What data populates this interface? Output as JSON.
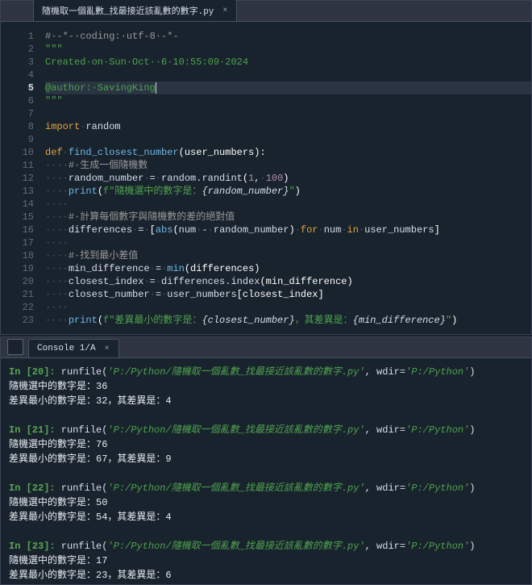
{
  "editor": {
    "tab": {
      "label": "隨機取一個亂數_找最接近該亂數的數字.py"
    },
    "lines": [
      {
        "n": 1,
        "parts": [
          {
            "cls": "c-cm",
            "t": "# -*- coding: utf-8 -*-"
          }
        ]
      },
      {
        "n": 2,
        "parts": [
          {
            "cls": "c-tri",
            "t": "\"\"\""
          }
        ]
      },
      {
        "n": 3,
        "parts": [
          {
            "cls": "c-tri",
            "t": "Created on Sun Oct  6 10:55:09 2024"
          }
        ]
      },
      {
        "n": 4,
        "parts": []
      },
      {
        "n": 5,
        "current": true,
        "hl": true,
        "parts": [
          {
            "cls": "c-tri",
            "t": "@author: SavingKing"
          }
        ],
        "cursor": true
      },
      {
        "n": 6,
        "parts": [
          {
            "cls": "c-tri",
            "t": "\"\"\""
          }
        ]
      },
      {
        "n": 7,
        "parts": []
      },
      {
        "n": 8,
        "parts": [
          {
            "cls": "c-kw",
            "t": "import"
          },
          {
            "cls": "c-ws",
            "t": " "
          },
          {
            "cls": "",
            "t": "random"
          }
        ]
      },
      {
        "n": 9,
        "parts": []
      },
      {
        "n": 10,
        "parts": [
          {
            "cls": "c-kw",
            "t": "def"
          },
          {
            "cls": "c-ws",
            "t": " "
          },
          {
            "cls": "c-def",
            "t": "find_closest_number"
          },
          {
            "cls": "c-par",
            "t": "(user_numbers):"
          }
        ]
      },
      {
        "n": 11,
        "parts": [
          {
            "cls": "c-ws",
            "t": "    "
          },
          {
            "cls": "c-cm",
            "t": "# 生成一個隨機數"
          }
        ]
      },
      {
        "n": 12,
        "parts": [
          {
            "cls": "c-ws",
            "t": "    "
          },
          {
            "cls": "",
            "t": "random_number"
          },
          {
            "cls": "c-ws",
            "t": " "
          },
          {
            "cls": "",
            "t": "="
          },
          {
            "cls": "c-ws",
            "t": " "
          },
          {
            "cls": "",
            "t": "random.randint"
          },
          {
            "cls": "c-par",
            "t": "("
          },
          {
            "cls": "c-num",
            "t": "1"
          },
          {
            "cls": "",
            "t": ","
          },
          {
            "cls": "c-ws",
            "t": " "
          },
          {
            "cls": "c-num",
            "t": "100"
          },
          {
            "cls": "c-par",
            "t": ")"
          }
        ]
      },
      {
        "n": 13,
        "parts": [
          {
            "cls": "c-ws",
            "t": "    "
          },
          {
            "cls": "c-def",
            "t": "print"
          },
          {
            "cls": "c-par",
            "t": "("
          },
          {
            "cls": "c-fstr",
            "t": "f\"隨機選中的數字是："
          },
          {
            "cls": "c-fexp",
            "t": "{random_number}"
          },
          {
            "cls": "c-fstr",
            "t": "\""
          },
          {
            "cls": "c-par",
            "t": ")"
          }
        ]
      },
      {
        "n": 14,
        "parts": [
          {
            "cls": "c-ws",
            "t": "    "
          }
        ]
      },
      {
        "n": 15,
        "parts": [
          {
            "cls": "c-ws",
            "t": "    "
          },
          {
            "cls": "c-cm",
            "t": "# 計算每個數字與隨機數的差的絕對值"
          }
        ]
      },
      {
        "n": 16,
        "parts": [
          {
            "cls": "c-ws",
            "t": "    "
          },
          {
            "cls": "",
            "t": "differences"
          },
          {
            "cls": "c-ws",
            "t": " "
          },
          {
            "cls": "",
            "t": "="
          },
          {
            "cls": "c-ws",
            "t": " "
          },
          {
            "cls": "c-par",
            "t": "["
          },
          {
            "cls": "c-def",
            "t": "abs"
          },
          {
            "cls": "c-par",
            "t": "("
          },
          {
            "cls": "",
            "t": "num"
          },
          {
            "cls": "c-ws",
            "t": " "
          },
          {
            "cls": "",
            "t": "-"
          },
          {
            "cls": "c-ws",
            "t": " "
          },
          {
            "cls": "",
            "t": "random_number"
          },
          {
            "cls": "c-par",
            "t": ")"
          },
          {
            "cls": "c-ws",
            "t": " "
          },
          {
            "cls": "c-kw",
            "t": "for"
          },
          {
            "cls": "c-ws",
            "t": " "
          },
          {
            "cls": "",
            "t": "num"
          },
          {
            "cls": "c-ws",
            "t": " "
          },
          {
            "cls": "c-kw",
            "t": "in"
          },
          {
            "cls": "c-ws",
            "t": " "
          },
          {
            "cls": "",
            "t": "user_numbers"
          },
          {
            "cls": "c-par",
            "t": "]"
          }
        ]
      },
      {
        "n": 17,
        "parts": [
          {
            "cls": "c-ws",
            "t": "    "
          }
        ]
      },
      {
        "n": 18,
        "parts": [
          {
            "cls": "c-ws",
            "t": "    "
          },
          {
            "cls": "c-cm",
            "t": "# 找到最小差值"
          }
        ]
      },
      {
        "n": 19,
        "parts": [
          {
            "cls": "c-ws",
            "t": "    "
          },
          {
            "cls": "",
            "t": "min_difference"
          },
          {
            "cls": "c-ws",
            "t": " "
          },
          {
            "cls": "",
            "t": "="
          },
          {
            "cls": "c-ws",
            "t": " "
          },
          {
            "cls": "c-def",
            "t": "min"
          },
          {
            "cls": "c-par",
            "t": "(differences)"
          }
        ]
      },
      {
        "n": 20,
        "parts": [
          {
            "cls": "c-ws",
            "t": "    "
          },
          {
            "cls": "",
            "t": "closest_index"
          },
          {
            "cls": "c-ws",
            "t": " "
          },
          {
            "cls": "",
            "t": "="
          },
          {
            "cls": "c-ws",
            "t": " "
          },
          {
            "cls": "",
            "t": "differences.index"
          },
          {
            "cls": "c-par",
            "t": "(min_difference)"
          }
        ]
      },
      {
        "n": 21,
        "parts": [
          {
            "cls": "c-ws",
            "t": "    "
          },
          {
            "cls": "",
            "t": "closest_number"
          },
          {
            "cls": "c-ws",
            "t": " "
          },
          {
            "cls": "",
            "t": "="
          },
          {
            "cls": "c-ws",
            "t": " "
          },
          {
            "cls": "",
            "t": "user_numbers"
          },
          {
            "cls": "c-par",
            "t": "[closest_index]"
          }
        ]
      },
      {
        "n": 22,
        "parts": [
          {
            "cls": "c-ws",
            "t": "    "
          }
        ]
      },
      {
        "n": 23,
        "parts": [
          {
            "cls": "c-ws",
            "t": "    "
          },
          {
            "cls": "c-def",
            "t": "print"
          },
          {
            "cls": "c-par",
            "t": "("
          },
          {
            "cls": "c-fstr",
            "t": "f\"差異最小的數字是："
          },
          {
            "cls": "c-fexp",
            "t": "{closest_number}"
          },
          {
            "cls": "c-fstr",
            "t": "，其差異是："
          },
          {
            "cls": "c-fexp",
            "t": "{min_difference}"
          },
          {
            "cls": "c-fstr",
            "t": "\""
          },
          {
            "cls": "c-par",
            "t": ")"
          }
        ]
      }
    ]
  },
  "console": {
    "tab": {
      "label": "Console 1/A"
    },
    "runs": [
      {
        "n": 20,
        "path": "'P:/Python/隨機取一個亂數_找最接近該亂數的數字.py'",
        "wdir": "'P:/Python'",
        "rand": "36",
        "closest": "32",
        "diff": "4"
      },
      {
        "n": 21,
        "path": "'P:/Python/隨機取一個亂數_找最接近該亂數的數字.py'",
        "wdir": "'P:/Python'",
        "rand": "76",
        "closest": "67",
        "diff": "9"
      },
      {
        "n": 22,
        "path": "'P:/Python/隨機取一個亂數_找最接近該亂數的數字.py'",
        "wdir": "'P:/Python'",
        "rand": "50",
        "closest": "54",
        "diff": "4"
      },
      {
        "n": 23,
        "path": "'P:/Python/隨機取一個亂數_找最接近該亂數的數字.py'",
        "wdir": "'P:/Python'",
        "rand": "17",
        "closest": "23",
        "diff": "6"
      }
    ],
    "strings": {
      "runfile": "runfile(",
      "wdir": ", wdir=",
      "rparen": ")",
      "randLine": "隨機選中的數字是：",
      "closestLinePre": "差異最小的數字是：",
      "closestLineMid": "，其差異是："
    }
  }
}
